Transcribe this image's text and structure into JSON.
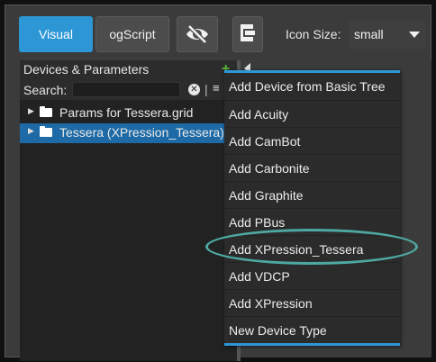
{
  "toolbar": {
    "tab_visual": "Visual",
    "tab_ogscript": "ogScript",
    "visibility_icon": "eye-slash-icon",
    "layout_icon": "layout-icon",
    "icon_size_label": "Icon Size:",
    "icon_size_value": "small"
  },
  "panel": {
    "title": "Devices & Parameters",
    "add_icon": "plus-icon",
    "search_label": "Search:",
    "search_value": "",
    "separator": "|",
    "tree": [
      {
        "label": "Params for Tessera.grid",
        "selected": false
      },
      {
        "label": "Tessera (XPression_Tessera)",
        "selected": true
      }
    ]
  },
  "menu": {
    "items": [
      "Add Device from Basic Tree",
      "Add Acuity",
      "Add CamBot",
      "Add Carbonite",
      "Add Graphite",
      "Add PBus",
      "Add XPression_Tessera",
      "Add VDCP",
      "Add XPression",
      "New Device Type"
    ],
    "highlighted_item": "Add XPression_Tessera"
  },
  "colors": {
    "accent": "#2d97d6",
    "selection": "#1d6aa6",
    "highlight_ring": "#4ea8a2",
    "add_green": "#55bb33"
  }
}
